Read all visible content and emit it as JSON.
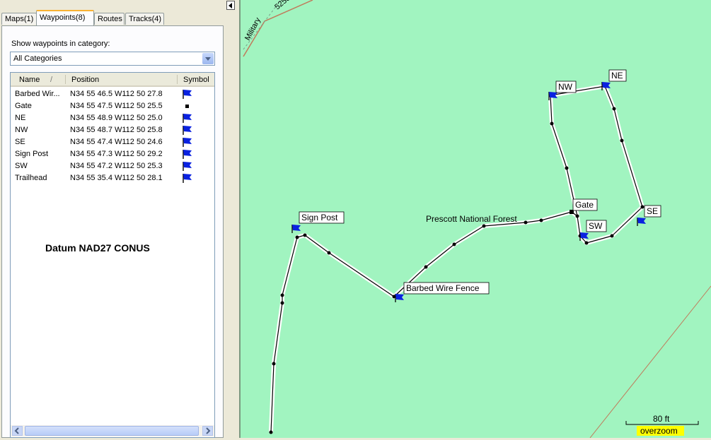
{
  "tabs": [
    {
      "label": "Maps(1)",
      "active": false
    },
    {
      "label": "Waypoints(8)",
      "active": true
    },
    {
      "label": "Routes",
      "active": false
    },
    {
      "label": "Tracks(4)",
      "active": false
    }
  ],
  "filter": {
    "label": "Show waypoints in category:",
    "selected": "All Categories"
  },
  "list": {
    "columns": [
      "Name",
      "Position",
      "Symbol"
    ],
    "sort_indicator": "/",
    "rows": [
      {
        "name": "Barbed Wir...",
        "position": "N34 55 46.5 W112 50 27.8",
        "symbol": "blue-flag"
      },
      {
        "name": "Gate",
        "position": "N34 55 47.5 W112 50 25.5",
        "symbol": "black-square"
      },
      {
        "name": "NE",
        "position": "N34 55 48.9 W112 50 25.0",
        "symbol": "blue-flag"
      },
      {
        "name": "NW",
        "position": "N34 55 48.7 W112 50 25.8",
        "symbol": "blue-flag"
      },
      {
        "name": "SE",
        "position": "N34 55 47.4 W112 50 24.6",
        "symbol": "blue-flag"
      },
      {
        "name": "Sign Post",
        "position": "N34 55 47.3 W112 50 29.2",
        "symbol": "blue-flag"
      },
      {
        "name": "SW",
        "position": "N34 55 47.2 W112 50 25.3",
        "symbol": "blue-flag"
      },
      {
        "name": "Trailhead",
        "position": "N34 55 35.4 W112 50 28.1",
        "symbol": "blue-flag"
      }
    ]
  },
  "datum": "Datum NAD27 CONUS",
  "map": {
    "background_color": "#a1f4c0",
    "road_label_1": "Military",
    "road_label_2": "5250",
    "area_label": "Prescott National Forest",
    "waypoint_labels": {
      "sign_post": "Sign Post",
      "barbed_wire": "Barbed Wire Fence",
      "gate": "Gate",
      "nw": "NW",
      "ne": "NE",
      "se": "SE",
      "sw": "SW"
    },
    "scale_label": "80 ft",
    "zoom_label": "overzoom"
  },
  "colors": {
    "flag": "#0a22e0",
    "track": "#000000",
    "zoom_badge": "#ffff00"
  }
}
